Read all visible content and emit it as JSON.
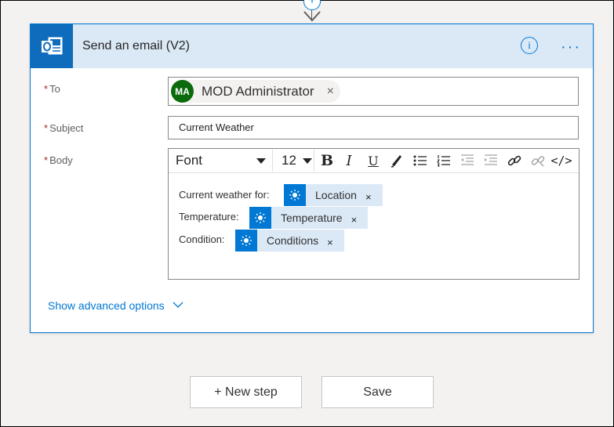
{
  "action": {
    "title": "Send an email (V2)",
    "info_symbol": "i",
    "more_symbol": "···"
  },
  "fields": {
    "to": {
      "label": "To",
      "required_mark": "*",
      "recipient_initials": "MA",
      "recipient_name": "MOD Administrator",
      "remove_symbol": "×"
    },
    "subject": {
      "label": "Subject",
      "required_mark": "*",
      "value": "Current Weather"
    },
    "body": {
      "label": "Body",
      "required_mark": "*",
      "toolbar": {
        "font": "Font",
        "size": "12",
        "bold": "B",
        "italic": "I",
        "underline": "U",
        "code": "</>"
      },
      "lines": [
        {
          "text": "Current weather for:",
          "token": "Location"
        },
        {
          "text": "Temperature:",
          "token": "Temperature"
        },
        {
          "text": "Condition:",
          "token": "Conditions"
        }
      ],
      "token_remove_symbol": "×"
    }
  },
  "advanced_options": "Show advanced options",
  "buttons": {
    "new_step": "+ New step",
    "save": "Save"
  },
  "colors": {
    "accent": "#0078d4",
    "header_bg": "#dbe9f7",
    "outlook_blue": "#0f6cbd",
    "avatar_green": "#0b6a0b",
    "required_red": "#a4262c"
  },
  "icons": {
    "app": "outlook-icon",
    "token": "sun-icon",
    "connector": "add-circle-icon"
  }
}
